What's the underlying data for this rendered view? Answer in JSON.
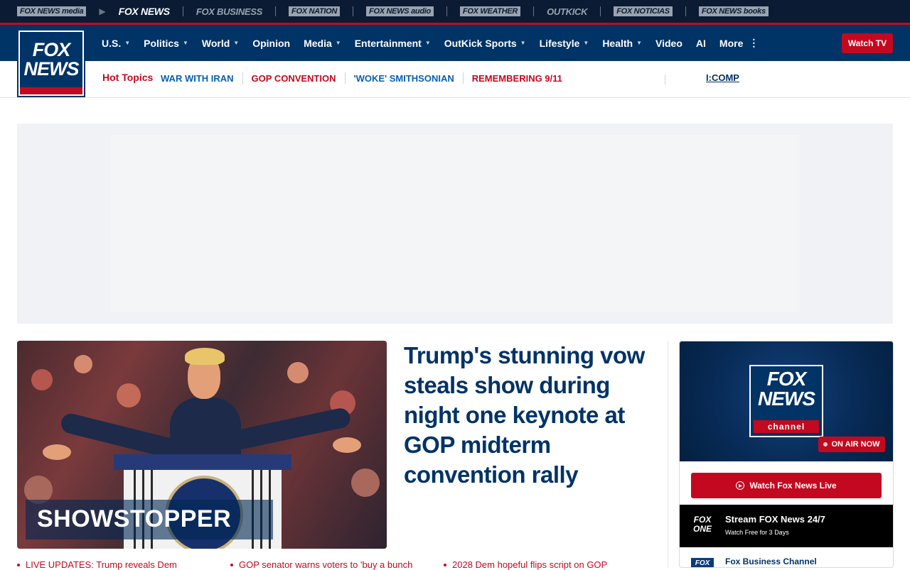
{
  "network_bar": {
    "items": [
      {
        "label": "FOX NEWS media"
      },
      {
        "label": "FOX NEWS"
      },
      {
        "label": "FOX BUSINESS"
      },
      {
        "label": "FOX NATION"
      },
      {
        "label": "FOX NEWS audio"
      },
      {
        "label": "FOX WEATHER"
      },
      {
        "label": "OUTKICK"
      },
      {
        "label": "FOX NOTICIAS"
      },
      {
        "label": "FOX NEWS books"
      }
    ]
  },
  "logo": {
    "line1": "FOX",
    "line2": "NEWS"
  },
  "nav": {
    "items": [
      {
        "label": "U.S."
      },
      {
        "label": "Politics"
      },
      {
        "label": "World"
      },
      {
        "label": "Opinion"
      },
      {
        "label": "Media"
      },
      {
        "label": "Entertainment"
      },
      {
        "label": "OutKick Sports"
      },
      {
        "label": "Lifestyle"
      },
      {
        "label": "Health"
      },
      {
        "label": "Video"
      },
      {
        "label": "AI"
      },
      {
        "label": "More"
      }
    ],
    "watch_tv": "Watch TV"
  },
  "hot_topics": {
    "label": "Hot Topics",
    "topics": [
      {
        "label": "WAR WITH IRAN"
      },
      {
        "label": "GOP CONVENTION"
      },
      {
        "label": "'WOKE' SMITHSONIAN"
      },
      {
        "label": "REMEMBERING 9/11"
      }
    ],
    "ticker": "I:COMP"
  },
  "hero": {
    "kicker": "SHOWSTOPPER",
    "headline": "Trump's stunning vow steals show during night one keynote at GOP midterm convention rally",
    "bullets": [
      "LIVE UPDATES: Trump reveals Dem",
      "GOP senator warns voters to 'buy a bunch",
      "2028 Dem hopeful flips script on GOP"
    ]
  },
  "watch_panel": {
    "logo_line1": "FOX",
    "logo_line2": "NEWS",
    "logo_channel": "channel",
    "on_air": "ON AIR NOW",
    "live_button": "Watch Fox News Live",
    "fox_one": {
      "logo_line1": "FOX",
      "logo_line2": "ONE",
      "title": "Stream FOX News 24/7",
      "subtitle": "Watch Free for 3 Days"
    },
    "fbc": {
      "logo": "FOX",
      "title": "Fox Business Channel"
    }
  },
  "colors": {
    "navy": "#003366",
    "red": "#c3091f",
    "link_blue": "#0b5fae"
  }
}
